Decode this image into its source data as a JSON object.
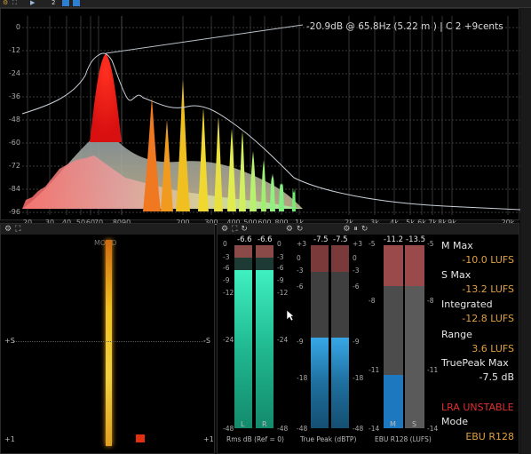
{
  "top_strip": {
    "counter": "2"
  },
  "spectrum": {
    "readout": "-20.9dB @    65.8Hz (5.22 m ) | C 2  +9cents",
    "y_labels": [
      "0",
      "-12",
      "-24",
      "-36",
      "-48",
      "-60",
      "-72",
      "-84",
      "-96"
    ],
    "x_labels": [
      "20",
      "30",
      "40",
      "50",
      "60",
      "70",
      "8090",
      "200",
      "300",
      "400",
      "500",
      "600",
      "800",
      "1k",
      "2k",
      "3k",
      "4k",
      "5k",
      "6k",
      "7k",
      "8k",
      "9k",
      "20k"
    ]
  },
  "goniometer": {
    "label": "MONO",
    "left_tick": "+S",
    "right_tick": "-S",
    "bottom_left": "+1",
    "bottom_right": "+1"
  },
  "meters": {
    "rms": {
      "left_val": "-6.6",
      "right_val": "-6.6",
      "title": "Rms dB (Ref = 0)",
      "ch_l": "L",
      "ch_r": "R",
      "scale_left": [
        "0",
        "-3",
        "-6",
        "-9",
        "-12",
        "-24",
        "-48"
      ],
      "scale_right": [
        "0",
        "-3",
        "-6",
        "-9",
        "-12",
        "-24",
        "-48"
      ]
    },
    "tp": {
      "left_val": "-7.5",
      "right_val": "-7.5",
      "title": "True Peak (dBTP)",
      "scale_left": [
        "+3",
        "0",
        "-3",
        "-6",
        "-9",
        "-18",
        "-48"
      ],
      "scale_right": [
        "+3",
        "0",
        "-3",
        "-6",
        "-9",
        "-18",
        "-48"
      ]
    },
    "ebu": {
      "left_val": "-11.2",
      "right_val": "-13.5",
      "title": "EBU R128 (LUFS)",
      "ch_m": "M",
      "ch_s": "S",
      "scale_left": [
        "-5",
        "-8",
        "-11",
        "-14"
      ],
      "scale_right": [
        "-5",
        "-8",
        "-11",
        "-14"
      ]
    }
  },
  "stats": {
    "m_max_label": "M Max",
    "m_max_value": "-10.0 LUFS",
    "s_max_label": "S Max",
    "s_max_value": "-13.2 LUFS",
    "integrated_label": "Integrated",
    "integrated_value": "-12.8 LUFS",
    "range_label": "Range",
    "range_value": "3.6 LUFS",
    "truepeak_label": "TruePeak Max",
    "truepeak_value": "-7.5 dB",
    "warning": "LRA UNSTABLE",
    "mode_label": "Mode",
    "mode_value": "EBU R128"
  },
  "colors": {
    "accent_orange": "#e0a040",
    "warning_red": "#e03030",
    "teal": "#27d3a8",
    "blue": "#2a8fd0"
  }
}
